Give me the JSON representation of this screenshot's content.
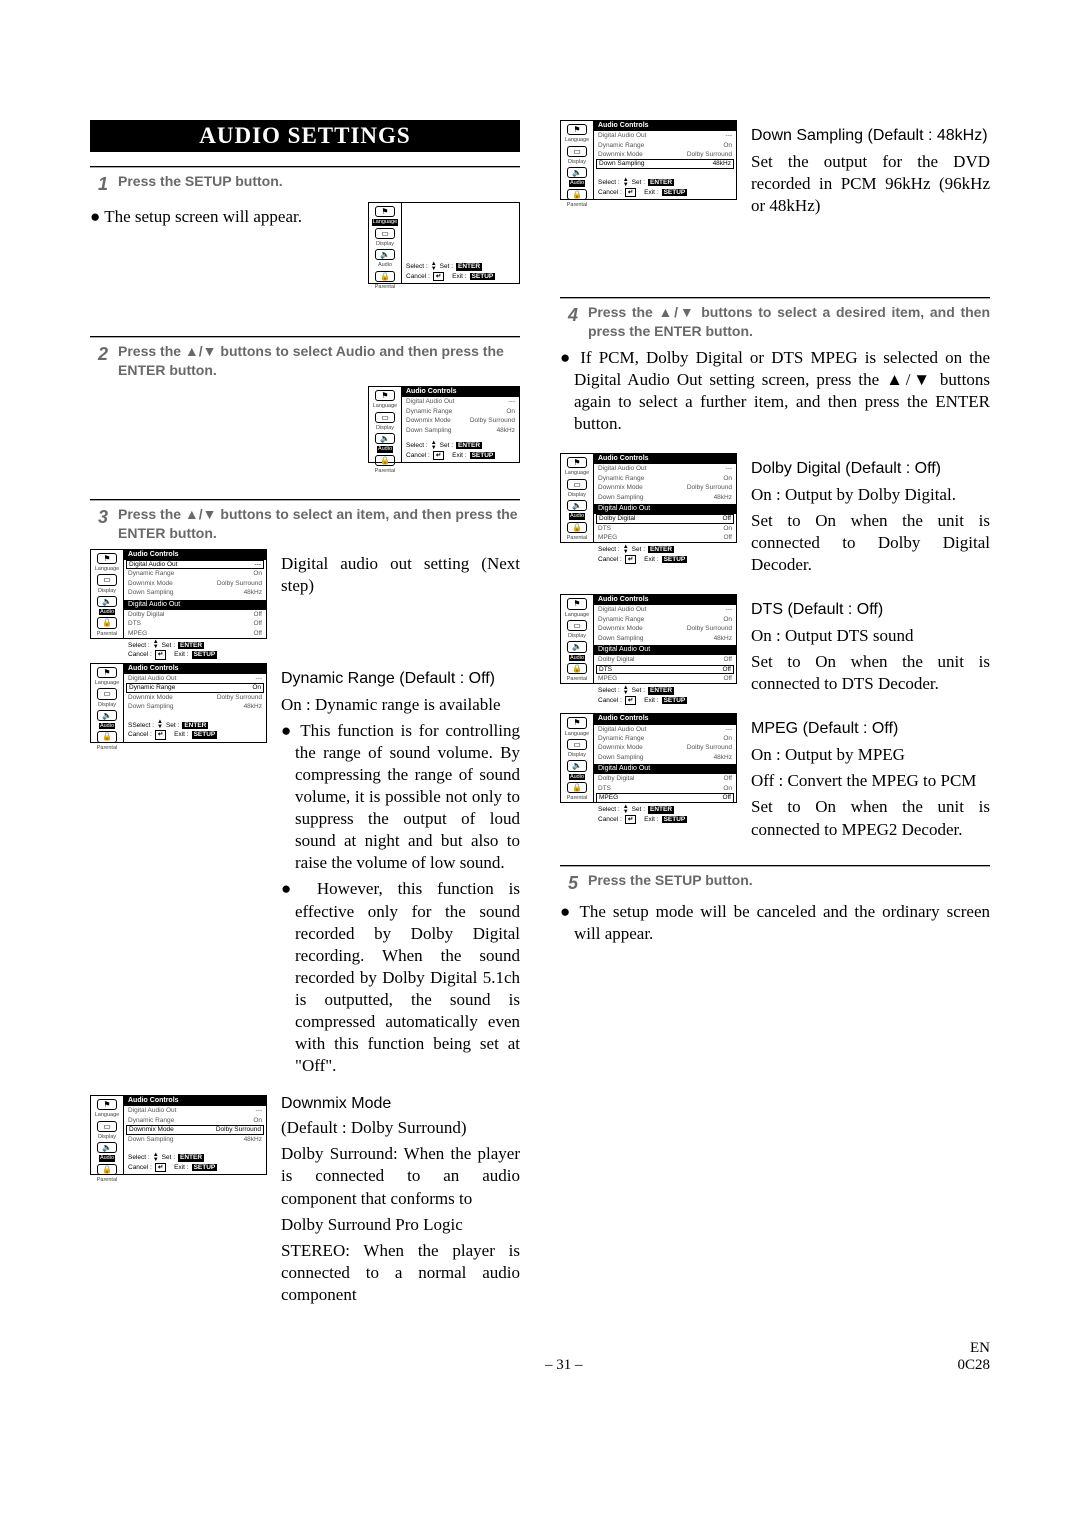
{
  "title": "AUDIO SETTINGS",
  "step1": {
    "num": "1",
    "text": "Press the SETUP button.",
    "body": "● The setup screen will appear."
  },
  "step2": {
    "num": "2",
    "text": "Press the ▲/▼ buttons to select Audio and then press the ENTER button."
  },
  "step3": {
    "num": "3",
    "text": "Press the ▲/▼ buttons to select an item, and then press the ENTER button."
  },
  "digital_audio_out": "Digital audio out setting (Next step)",
  "dyn": {
    "head": "Dynamic Range (Default : Off)",
    "line": "On : Dynamic range is available",
    "b1": "● This function is for controlling the range of sound volume. By compressing the range of sound volume, it is possible not only to suppress the output of loud sound at night and but also to raise the volume of low sound.",
    "b2": "● However, this function is effective only for the sound recorded by Dolby Digital recording. When the sound recorded by Dolby Digital 5.1ch is outputted, the sound is compressed automatically even with this function being set at \"Off\"."
  },
  "downmix": {
    "head": "Downmix Mode",
    "def": "(Default : Dolby Surround)",
    "l1": "Dolby Surround: When the player is connected to an audio component that conforms to",
    "l2": "Dolby Surround Pro Logic",
    "l3": "STEREO: When the player is connected to a normal audio component"
  },
  "downsamp": {
    "head": "Down Sampling (Default : 48kHz)",
    "body": "Set the output for the DVD recorded in PCM 96kHz (96kHz or 48kHz)"
  },
  "step4": {
    "num": "4",
    "text": "Press the ▲/▼ buttons to select a desired item, and then press the ENTER button.",
    "body": "● If PCM, Dolby Digital or DTS MPEG is selected on the Digital Audio Out setting screen, press the ▲/▼ buttons again to select a further item, and then press the ENTER button."
  },
  "dolby": {
    "head": "Dolby Digital (Default : Off)",
    "l1": "On : Output by Dolby Digital.",
    "l2": "Set to On when the unit is connected to Dolby Digital Decoder."
  },
  "dts": {
    "head": "DTS (Default : Off)",
    "l1": "On : Output DTS sound",
    "l2": "Set to On when the unit is connected to DTS Decoder."
  },
  "mpeg": {
    "head": "MPEG (Default : Off)",
    "l1": "On : Output by MPEG",
    "l2": "Off : Convert the MPEG to PCM",
    "l3": "Set to On when the unit is connected to MPEG2 Decoder."
  },
  "step5": {
    "num": "5",
    "text": "Press the SETUP button.",
    "body": "● The setup mode will be canceled and the ordinary screen will appear."
  },
  "osd": {
    "left": {
      "lang": "Language",
      "disp": "Display",
      "audio": "Audio",
      "par": "Parental"
    },
    "title": "Audio Controls",
    "rows": {
      "dao": "Digital Audio Out",
      "dr": "Dynamic Range",
      "dm": "Downmix Mode",
      "ds": "Down Sampling",
      "v_on": "On",
      "v_ds": "Dolby Surround",
      "v_48": "48kHz",
      "sep": "---"
    },
    "sect": "Digital Audio Out",
    "sub": {
      "dd": "Dolby Digital",
      "dts": "DTS",
      "mpeg": "MPEG",
      "off": "Off",
      "on": "On"
    },
    "foot": {
      "select": "Select :",
      "set": "Set :",
      "enter": "ENTER",
      "cancel": "Cancel :",
      "ret": "↵",
      "exit": "Exit :",
      "setup": "SETUP",
      "sselect": "SSelect :"
    }
  },
  "footer": {
    "page": "– 31 –",
    "code1": "EN",
    "code2": "0C28"
  }
}
